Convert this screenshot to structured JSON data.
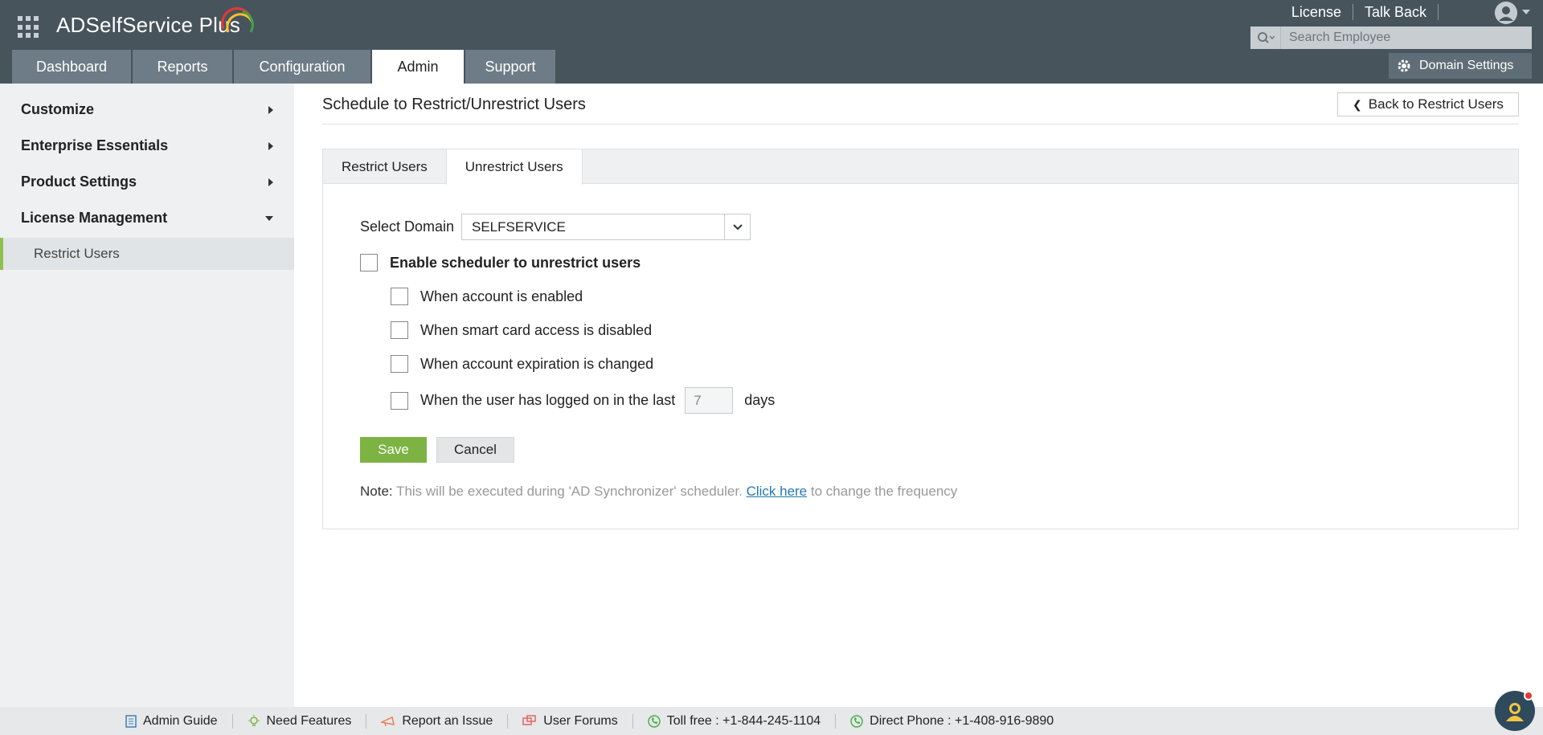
{
  "app": {
    "title": "ADSelfService Plus"
  },
  "header": {
    "links": [
      "License",
      "Talk Back"
    ],
    "search_placeholder": "Search Employee",
    "domain_settings": "Domain Settings"
  },
  "nav": {
    "tabs": [
      {
        "label": "Dashboard",
        "active": false
      },
      {
        "label": "Reports",
        "active": false
      },
      {
        "label": "Configuration",
        "active": false
      },
      {
        "label": "Admin",
        "active": true
      },
      {
        "label": "Support",
        "active": false
      }
    ]
  },
  "sidebar": {
    "items": [
      {
        "label": "Customize",
        "expanded": false
      },
      {
        "label": "Enterprise Essentials",
        "expanded": false
      },
      {
        "label": "Product Settings",
        "expanded": false
      },
      {
        "label": "License Management",
        "expanded": true
      }
    ],
    "sub_item": "Restrict Users"
  },
  "main": {
    "title": "Schedule to Restrict/Unrestrict Users",
    "back_button": "Back to Restrict Users",
    "tabs": [
      {
        "label": "Restrict Users",
        "active": false
      },
      {
        "label": "Unrestrict Users",
        "active": true
      }
    ],
    "domain_label": "Select Domain",
    "domain_value": "SELFSERVICE",
    "enable_label": "Enable scheduler to unrestrict users",
    "options": [
      "When account is enabled",
      "When smart card access is disabled",
      "When account expiration is changed"
    ],
    "logged_on_label": "When the user has logged on in the last",
    "days_value": "7",
    "days_unit": "days",
    "save": "Save",
    "cancel": "Cancel",
    "note_label": "Note:",
    "note_text": "This will be executed during 'AD Synchronizer' scheduler.",
    "note_link": "Click here",
    "note_suffix": "to change the frequency"
  },
  "footer": {
    "items": [
      "Admin Guide",
      "Need Features",
      "Report an Issue",
      "User Forums",
      "Toll free : +1-844-245-1104",
      "Direct Phone : +1-408-916-9890"
    ]
  },
  "colors": {
    "header_bg": "#47545c",
    "tab_bg": "#6d7c86",
    "accent_green": "#7cb342",
    "link_blue": "#1f78b4",
    "sidebar_bg": "#eef0f1"
  }
}
